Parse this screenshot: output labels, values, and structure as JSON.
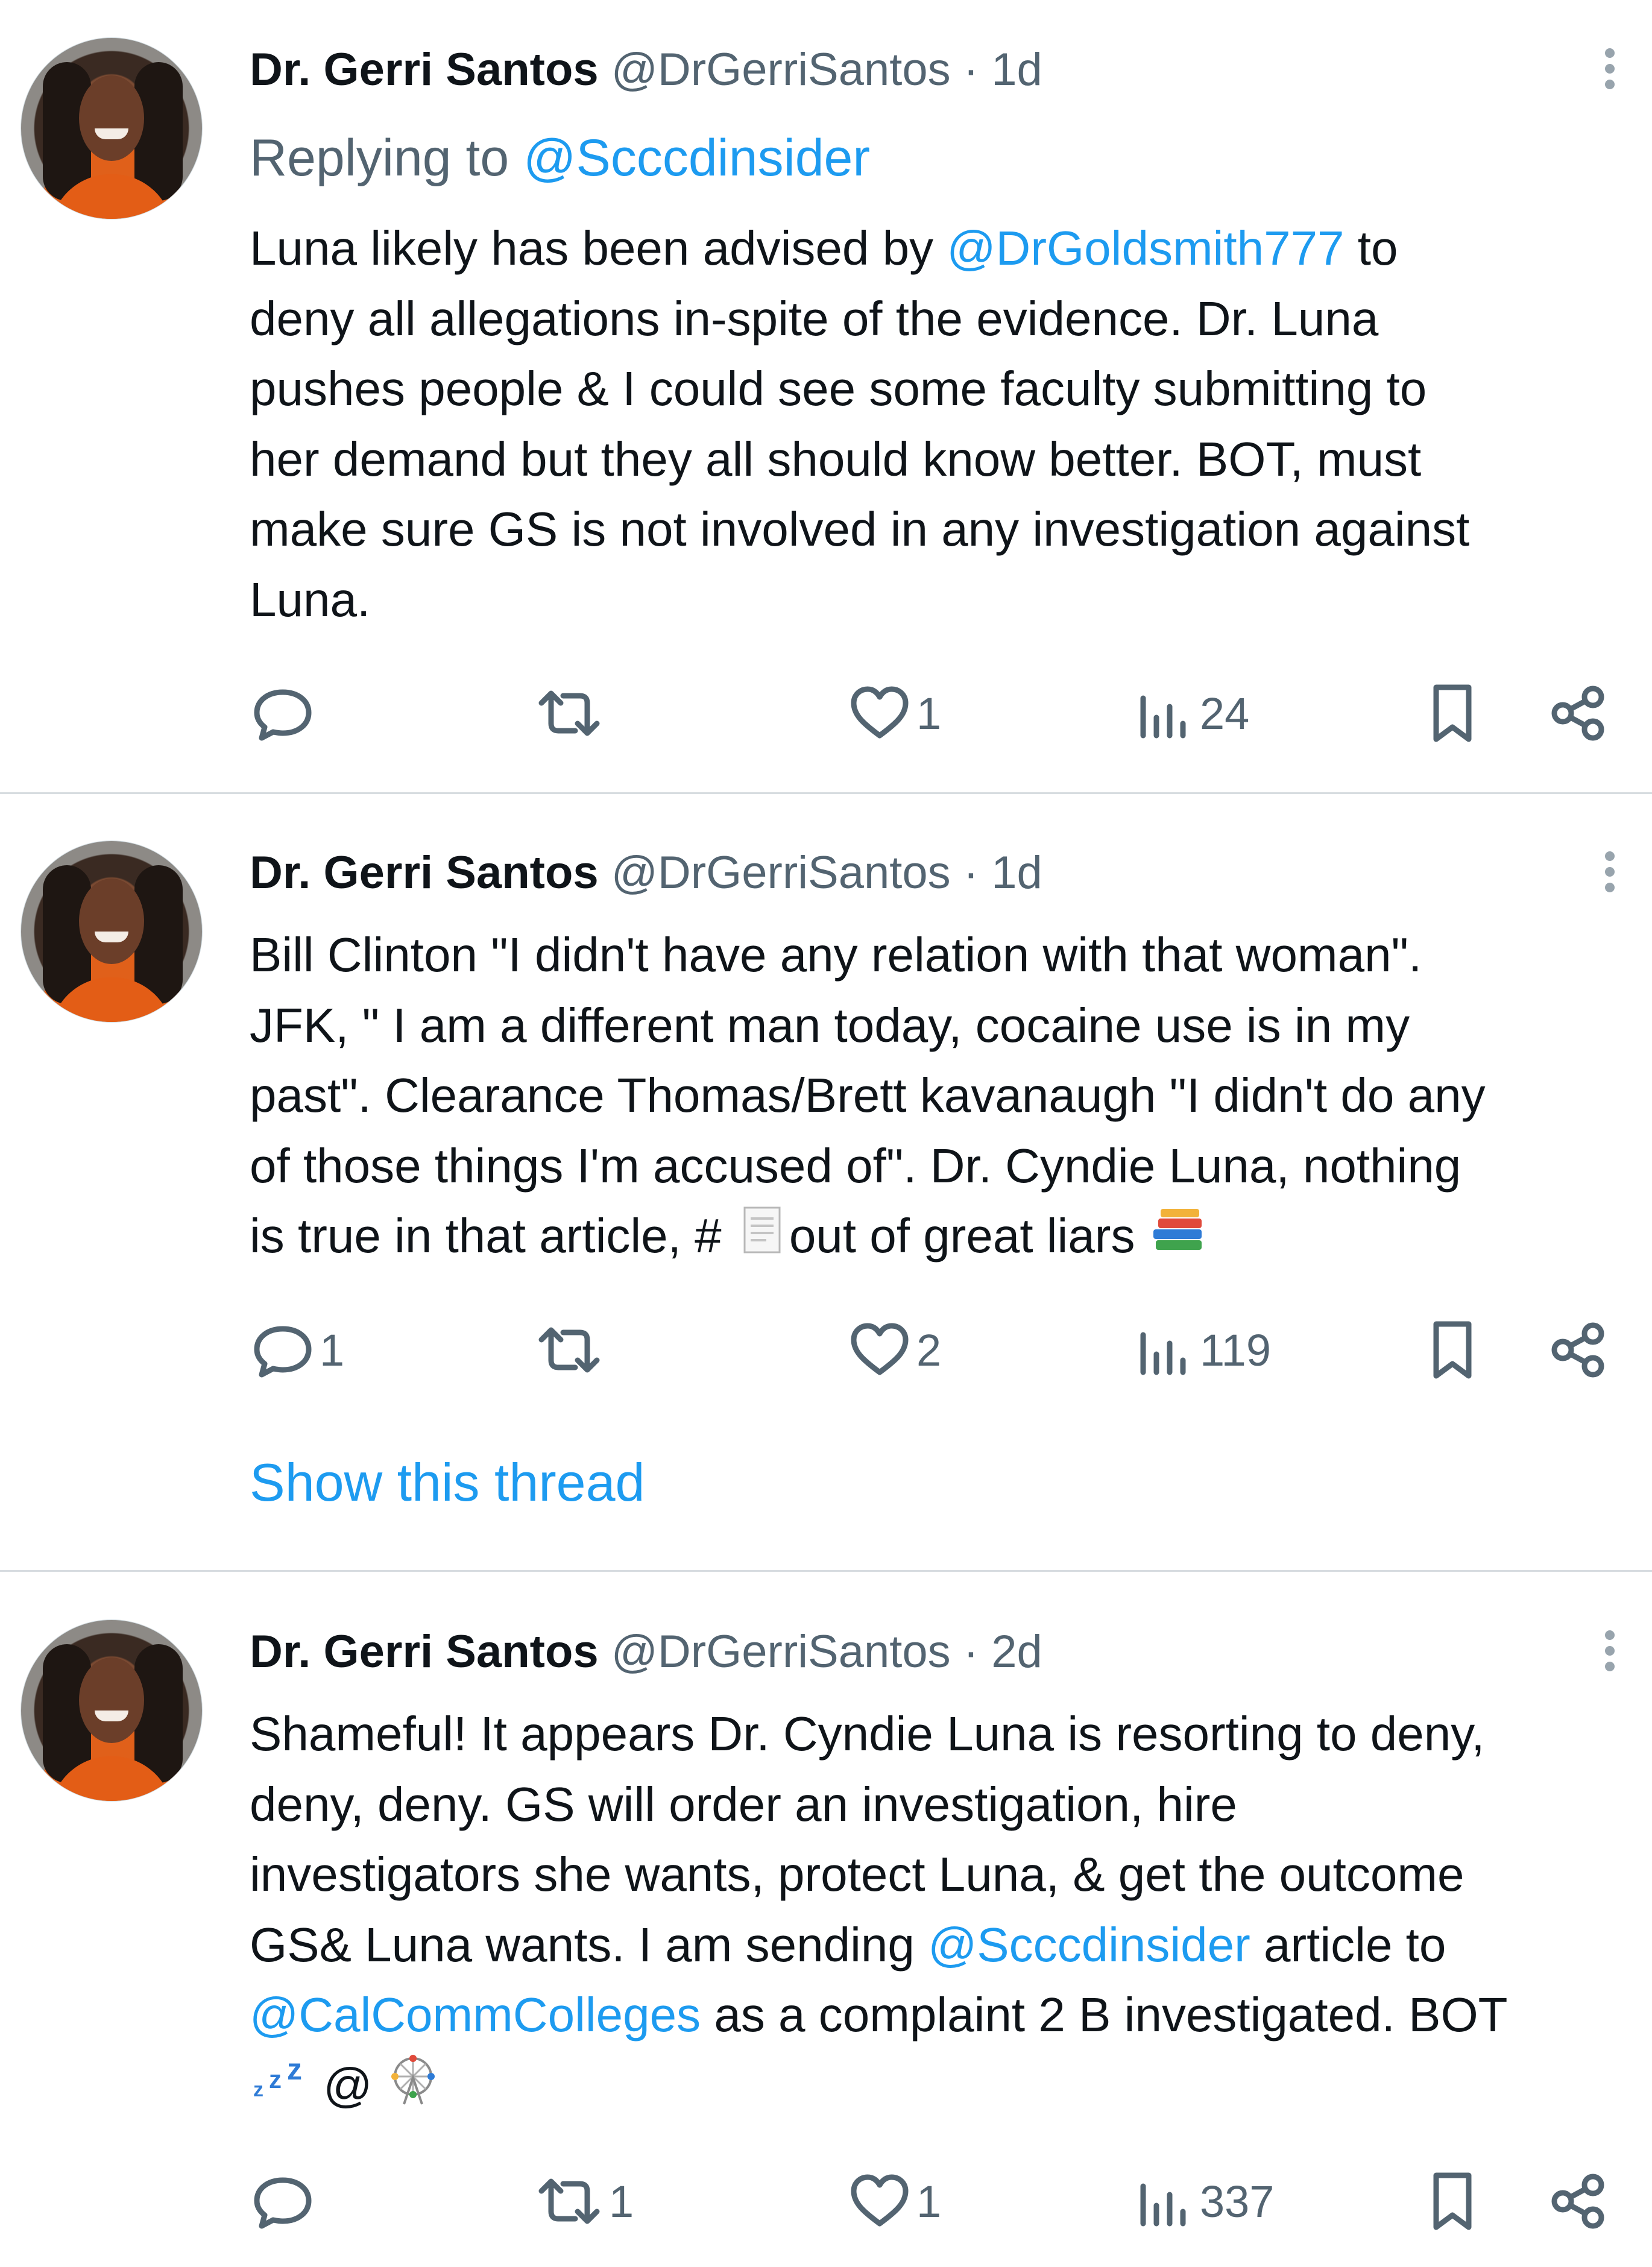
{
  "accent_color": "#1d9bf0",
  "tweets": [
    {
      "name": "Dr. Gerri Santos",
      "handle": "@DrGerriSantos",
      "sep": "·",
      "time": "1d",
      "replying_prefix": "Replying to",
      "replying_handle": "@Scccdinsider",
      "lines": [
        [
          "Luna likely has been advised by ",
          "@DrGoldsmith777",
          " to"
        ],
        [
          "deny all allegations in-spite of the evidence. Dr. Luna"
        ],
        [
          "pushes people & I could see some faculty submitting to"
        ],
        [
          "her demand but they all should know better. BOT, must"
        ],
        [
          "make sure GS is not involved in any investigation against"
        ],
        [
          "Luna."
        ]
      ],
      "actions": {
        "reply": "",
        "retweet": "",
        "like": "1",
        "views": "24"
      }
    },
    {
      "name": "Dr. Gerri Santos",
      "handle": "@DrGerriSantos",
      "sep": "·",
      "time": "1d",
      "lines": [
        [
          "Bill Clinton \"I didn't have any relation with that woman\"."
        ],
        [
          "JFK, \" I am a different man today, cocaine use is in my"
        ],
        [
          "past\". Clearance Thomas/Brett kavanaugh \"I didn't do any"
        ],
        [
          "of those things I'm accused of\". Dr. Cyndie Luna, nothing"
        ],
        [
          "is true in that article, # ",
          "out of great liars "
        ]
      ],
      "actions": {
        "reply": "1",
        "retweet": "",
        "like": "2",
        "views": "119"
      },
      "show_thread": "Show this thread"
    },
    {
      "name": "Dr. Gerri Santos",
      "handle": "@DrGerriSantos",
      "sep": "·",
      "time": "2d",
      "lines": [
        [
          "Shameful! It appears Dr. Cyndie Luna is resorting to deny,"
        ],
        [
          "deny, deny. GS will order an investigation, hire"
        ],
        [
          "investigators she wants, protect Luna, & get the outcome"
        ],
        [
          "GS& Luna wants. I am sending ",
          "@Scccdinsider",
          " article to"
        ],
        [
          "",
          "@CalCommColleges",
          " as a complaint 2 B investigated. BOT"
        ],
        [
          "zzz-emoji",
          " @ ",
          "ferris-wheel-emoji"
        ]
      ],
      "actions": {
        "reply": "",
        "retweet": "1",
        "like": "1",
        "views": "337"
      }
    }
  ],
  "icons": {
    "reply": "reply-icon",
    "retweet": "retweet-icon",
    "like": "heart-icon",
    "views": "views-icon",
    "bookmark": "bookmark-icon",
    "share": "share-icon",
    "more": "more-vertical-icon"
  }
}
